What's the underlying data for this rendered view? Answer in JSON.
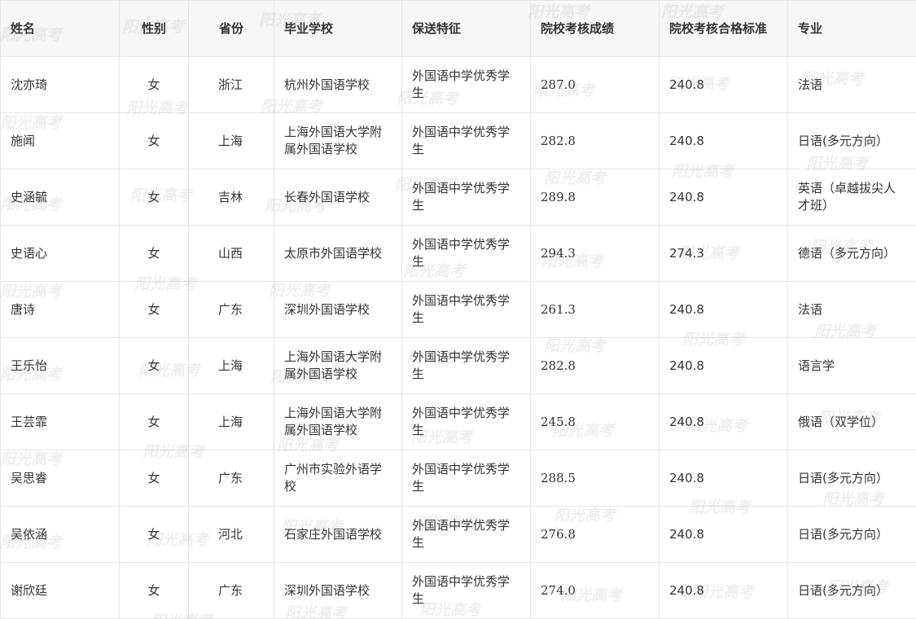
{
  "table": {
    "headers": [
      "姓名",
      "性别",
      "省份",
      "毕业学校",
      "保送特征",
      "院校考核成绩",
      "院校考核合格标准",
      "专业"
    ],
    "rows": [
      [
        "沈亦琦",
        "女",
        "浙江",
        "杭州外国语学校",
        "外国语中学优秀学生",
        "287.0",
        "240.8",
        "法语"
      ],
      [
        "施闻",
        "女",
        "上海",
        "上海外国语大学附属外国语学校",
        "外国语中学优秀学生",
        "282.8",
        "240.8",
        "日语(多元方向）"
      ],
      [
        "史涵毓",
        "女",
        "吉林",
        "长春外国语学校",
        "外国语中学优秀学生",
        "289.8",
        "240.8",
        "英语（卓越拔尖人才班）"
      ],
      [
        "史语心",
        "女",
        "山西",
        "太原市外国语学校",
        "外国语中学优秀学生",
        "294.3",
        "274.3",
        "德语（多元方向）"
      ],
      [
        "唐诗",
        "女",
        "广东",
        "深圳外国语学校",
        "外国语中学优秀学生",
        "261.3",
        "240.8",
        "法语"
      ],
      [
        "王乐怡",
        "女",
        "上海",
        "上海外国语大学附属外国语学校",
        "外国语中学优秀学生",
        "282.8",
        "240.8",
        "语言学"
      ],
      [
        "王芸霏",
        "女",
        "上海",
        "上海外国语大学附属外国语学校",
        "外国语中学优秀学生",
        "245.8",
        "240.8",
        "俄语（双学位）"
      ],
      [
        "吴思睿",
        "女",
        "广东",
        "广州市实验外语学校",
        "外国语中学优秀学生",
        "288.5",
        "240.8",
        "日语(多元方向）"
      ],
      [
        "吴依涵",
        "女",
        "河北",
        "石家庄外国语学校",
        "外国语中学优秀学生",
        "276.8",
        "240.8",
        "日语(多元方向）"
      ],
      [
        "谢欣廷",
        "女",
        "广东",
        "深圳外国语学校",
        "外国语中学优秀学生",
        "274.0",
        "240.8",
        "日语(多元方向）"
      ]
    ]
  },
  "watermark": {
    "text": "阳光高考"
  }
}
